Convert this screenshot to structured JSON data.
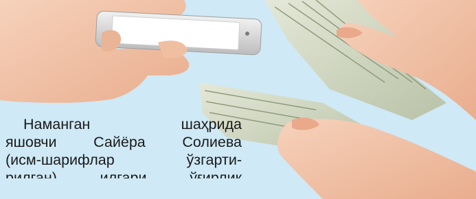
{
  "article": {
    "lines": [
      "Наманган шаҳрида",
      "яшовчи Сайёра Солиева",
      "(исм-шарифлар ўзгарти-",
      "рилган) илгари ўғирлик"
    ]
  },
  "colors": {
    "background": "#cfe9f6",
    "skin": "#f2c4a8",
    "banknote": "#cfd6bf",
    "phone_body": "#d9d9d9",
    "phone_screen": "#ffffff"
  },
  "scene": {
    "left_photo": "hand-holding-smartphone",
    "right_photo": "hand-passing-dollar-banknotes"
  }
}
